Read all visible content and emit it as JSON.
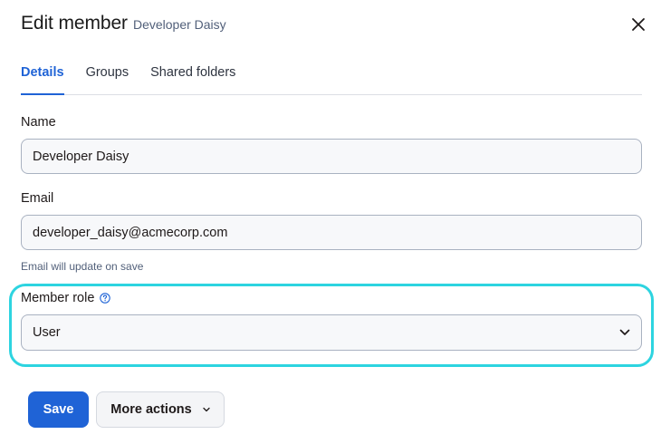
{
  "dialog": {
    "title": "Edit member",
    "subtitle": "Developer Daisy",
    "close_icon": "close-icon"
  },
  "tabs": [
    {
      "label": "Details",
      "active": true
    },
    {
      "label": "Groups",
      "active": false
    },
    {
      "label": "Shared folders",
      "active": false
    }
  ],
  "form": {
    "name_label": "Name",
    "name_value": "Developer Daisy",
    "email_label": "Email",
    "email_value": "developer_daisy@acmecorp.com",
    "email_hint": "Email will update on save",
    "role_label": "Member role",
    "role_help_icon": "help-circle-icon",
    "role_value": "User",
    "role_chevron_icon": "chevron-down-icon"
  },
  "actions": {
    "save_label": "Save",
    "more_label": "More actions",
    "more_chevron_icon": "chevron-down-icon"
  },
  "colors": {
    "accent": "#1f63d6",
    "highlight": "#2dd4e0"
  }
}
